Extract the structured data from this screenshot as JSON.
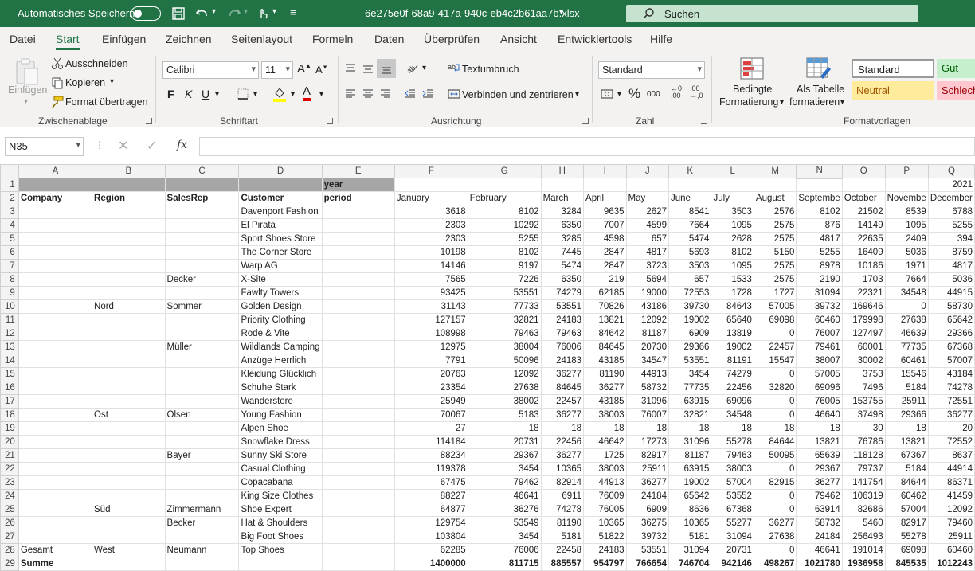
{
  "titlebar": {
    "autosave_label": "Automatisches Speichern",
    "filename": "6e275e0f-68a9-417a-940c-eb4c2b61aa7b.xlsx",
    "search_placeholder": "Suchen"
  },
  "menu": [
    "Datei",
    "Start",
    "Einfügen",
    "Zeichnen",
    "Seitenlayout",
    "Formeln",
    "Daten",
    "Überprüfen",
    "Ansicht",
    "Entwicklertools",
    "Hilfe"
  ],
  "ribbon": {
    "clipboard": {
      "group": "Zwischenablage",
      "paste": "Einfügen",
      "cut": "Ausschneiden",
      "copy": "Kopieren",
      "format_painter": "Format übertragen"
    },
    "font": {
      "group": "Schriftart",
      "name": "Calibri",
      "size": "11",
      "bold": "F",
      "italic": "K",
      "underline": "U"
    },
    "alignment": {
      "group": "Ausrichtung",
      "wrap": "Textumbruch",
      "merge": "Verbinden und zentrieren"
    },
    "number": {
      "group": "Zahl",
      "format": "Standard",
      "thousands": "000"
    },
    "styles": {
      "group": "Formatvorlagen",
      "conditional_1": "Bedingte",
      "conditional_2": "Formatierung",
      "table_1": "Als Tabelle",
      "table_2": "formatieren",
      "standard": "Standard",
      "gut": "Gut",
      "neutral": "Neutral",
      "schlecht": "Schlech"
    }
  },
  "formula": {
    "name_box": "N35",
    "fx": "fx",
    "value": ""
  },
  "sheet": {
    "columns": [
      "A",
      "B",
      "C",
      "D",
      "E",
      "F",
      "G",
      "H",
      "I",
      "J",
      "K",
      "L",
      "M",
      "N",
      "O",
      "P",
      "Q"
    ],
    "selected_column": "N",
    "row1": {
      "E": "year",
      "Q": "2021"
    },
    "headers": [
      "Company",
      "Region",
      "SalesRep",
      "Customer",
      "period",
      "January",
      "February",
      "March",
      "April",
      "May",
      "June",
      "July",
      "August",
      "Septembe",
      "October",
      "Novembe",
      "December"
    ],
    "rows": [
      {
        "r": 3,
        "a": "",
        "b": "",
        "c": "",
        "d": "Davenport Fashion",
        "v": [
          3618,
          8102,
          3284,
          9635,
          2627,
          8541,
          3503,
          2576,
          8102,
          21502,
          8539,
          6788
        ]
      },
      {
        "r": 4,
        "a": "",
        "b": "",
        "c": "",
        "d": "El Pirata",
        "v": [
          2303,
          10292,
          6350,
          7007,
          4599,
          7664,
          1095,
          2575,
          876,
          14149,
          1095,
          5255
        ]
      },
      {
        "r": 5,
        "a": "",
        "b": "",
        "c": "",
        "d": "Sport Shoes Store",
        "v": [
          2303,
          5255,
          3285,
          4598,
          657,
          5474,
          2628,
          2575,
          4817,
          22635,
          2409,
          394
        ]
      },
      {
        "r": 6,
        "a": "",
        "b": "",
        "c": "",
        "d": "The Corner Store",
        "v": [
          10198,
          8102,
          7445,
          2847,
          4817,
          5693,
          8102,
          5150,
          5255,
          16409,
          5036,
          8759
        ]
      },
      {
        "r": 7,
        "a": "",
        "b": "",
        "c": "",
        "d": "Warp AG",
        "v": [
          14146,
          9197,
          5474,
          2847,
          3723,
          3503,
          1095,
          2575,
          8978,
          10186,
          1971,
          4817
        ]
      },
      {
        "r": 8,
        "a": "",
        "b": "",
        "c": "Decker",
        "d": "X-Site",
        "v": [
          7565,
          7226,
          6350,
          219,
          5694,
          657,
          1533,
          2575,
          2190,
          1703,
          7664,
          5036
        ]
      },
      {
        "r": 9,
        "a": "",
        "b": "",
        "c": "",
        "d": "Fawlty Towers",
        "v": [
          93425,
          53551,
          74279,
          62185,
          19000,
          72553,
          1728,
          1727,
          31094,
          22321,
          34548,
          44915
        ]
      },
      {
        "r": 10,
        "a": "",
        "b": "Nord",
        "c": "Sommer",
        "d": "Golden Design",
        "v": [
          31143,
          77733,
          53551,
          70826,
          43186,
          39730,
          84643,
          57005,
          39732,
          169646,
          0,
          58730
        ]
      },
      {
        "r": 11,
        "a": "",
        "b": "",
        "c": "",
        "d": "Priority Clothing",
        "v": [
          127157,
          32821,
          24183,
          13821,
          12092,
          19002,
          65640,
          69098,
          60460,
          179998,
          27638,
          65642
        ]
      },
      {
        "r": 12,
        "a": "",
        "b": "",
        "c": "",
        "d": "Rode & Vite",
        "v": [
          108998,
          79463,
          79463,
          84642,
          81187,
          6909,
          13819,
          0,
          76007,
          127497,
          46639,
          29366
        ]
      },
      {
        "r": 13,
        "a": "",
        "b": "",
        "c": "Müller",
        "d": "Wildlands Camping",
        "v": [
          12975,
          38004,
          76006,
          84645,
          20730,
          29366,
          19002,
          22457,
          79461,
          60001,
          77735,
          67368
        ]
      },
      {
        "r": 14,
        "a": "",
        "b": "",
        "c": "",
        "d": "Anzüge Herrlich",
        "v": [
          7791,
          50096,
          24183,
          43185,
          34547,
          53551,
          81191,
          15547,
          38007,
          30002,
          60461,
          57007
        ]
      },
      {
        "r": 15,
        "a": "",
        "b": "",
        "c": "",
        "d": "Kleidung Glücklich",
        "v": [
          20763,
          12092,
          36277,
          81190,
          44913,
          3454,
          74279,
          0,
          57005,
          3753,
          15546,
          43184
        ]
      },
      {
        "r": 16,
        "a": "",
        "b": "",
        "c": "",
        "d": "Schuhe Stark",
        "v": [
          23354,
          27638,
          84645,
          36277,
          58732,
          77735,
          22456,
          32820,
          69096,
          7496,
          5184,
          74278
        ]
      },
      {
        "r": 17,
        "a": "",
        "b": "",
        "c": "",
        "d": "Wanderstore",
        "v": [
          25949,
          38002,
          22457,
          43185,
          31096,
          63915,
          69096,
          0,
          76005,
          153755,
          25911,
          72551
        ]
      },
      {
        "r": 18,
        "a": "",
        "b": "Ost",
        "c": "Olsen",
        "d": "Young Fashion",
        "v": [
          70067,
          5183,
          36277,
          38003,
          76007,
          32821,
          34548,
          0,
          46640,
          37498,
          29366,
          36277
        ]
      },
      {
        "r": 19,
        "a": "",
        "b": "",
        "c": "",
        "d": "Alpen Shoe",
        "v": [
          27,
          18,
          18,
          18,
          18,
          18,
          18,
          18,
          18,
          30,
          18,
          20
        ]
      },
      {
        "r": 20,
        "a": "",
        "b": "",
        "c": "",
        "d": "Snowflake Dress",
        "v": [
          114184,
          20731,
          22456,
          46642,
          17273,
          31096,
          55278,
          84644,
          13821,
          76786,
          13821,
          72552
        ]
      },
      {
        "r": 21,
        "a": "",
        "b": "",
        "c": "Bayer",
        "d": "Sunny Ski Store",
        "v": [
          88234,
          29367,
          36277,
          1725,
          82917,
          81187,
          79463,
          50095,
          65639,
          118128,
          67367,
          8637
        ]
      },
      {
        "r": 22,
        "a": "",
        "b": "",
        "c": "",
        "d": "Casual Clothing",
        "v": [
          119378,
          3454,
          10365,
          38003,
          25911,
          63915,
          38003,
          0,
          29367,
          79737,
          5184,
          44914
        ]
      },
      {
        "r": 23,
        "a": "",
        "b": "",
        "c": "",
        "d": "Copacabana",
        "v": [
          67475,
          79462,
          82914,
          44913,
          36277,
          19002,
          57004,
          82915,
          36277,
          141754,
          84644,
          86371
        ]
      },
      {
        "r": 24,
        "a": "",
        "b": "",
        "c": "",
        "d": "King Size Clothes",
        "v": [
          88227,
          46641,
          6911,
          76009,
          24184,
          65642,
          53552,
          0,
          79462,
          106319,
          60462,
          41459
        ]
      },
      {
        "r": 25,
        "a": "",
        "b": "Süd",
        "c": "Zimmermann",
        "d": "Shoe Expert",
        "v": [
          64877,
          36276,
          74278,
          76005,
          6909,
          8636,
          67368,
          0,
          63914,
          82686,
          57004,
          12092
        ]
      },
      {
        "r": 26,
        "a": "",
        "b": "",
        "c": "Becker",
        "d": "Hat & Shoulders",
        "v": [
          129754,
          53549,
          81190,
          10365,
          36275,
          10365,
          55277,
          36277,
          58732,
          5460,
          82917,
          79460
        ]
      },
      {
        "r": 27,
        "a": "",
        "b": "",
        "c": "",
        "d": "Big Foot Shoes",
        "v": [
          103804,
          3454,
          5181,
          51822,
          39732,
          5181,
          31094,
          27638,
          24184,
          256493,
          55278,
          25911
        ]
      },
      {
        "r": 28,
        "a": "Gesamt",
        "b": "West",
        "c": "Neumann",
        "d": "Top Shoes",
        "v": [
          62285,
          76006,
          22458,
          24183,
          53551,
          31094,
          20731,
          0,
          46641,
          191014,
          69098,
          60460
        ]
      }
    ],
    "total": {
      "r": 29,
      "label": "Summe",
      "v": [
        1400000,
        811715,
        885557,
        954797,
        766654,
        746704,
        942146,
        498267,
        1021780,
        1936958,
        845535,
        1012243
      ]
    }
  }
}
